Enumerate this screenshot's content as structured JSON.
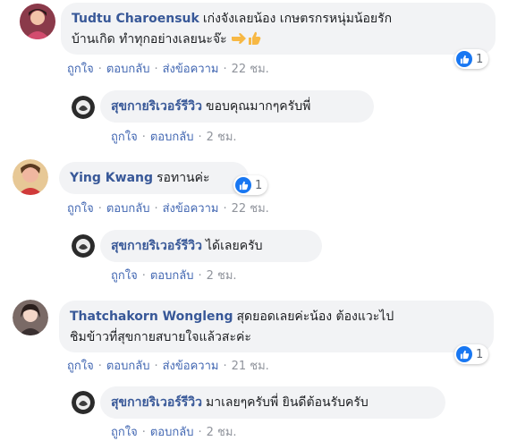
{
  "comments": [
    {
      "author": "Tudtu Charoensuk",
      "text_line1": "เก่งจังเลยน้อง เกษตรกรหนุ่มน้อยรัก",
      "text_line2": "บ้านเกิด ทำทุกอย่างเลยนะจ๊ะ",
      "emojis": [
        "point-right-icon",
        "thumbs-up-icon"
      ],
      "like_label": "ถูกใจ",
      "reply_label": "ตอบกลับ",
      "message_label": "ส่งข้อความ",
      "time": "22 ชม.",
      "reaction_count": "1",
      "avatar_color": "#c44d6a",
      "reply": {
        "author": "สุขกายริเวอร์รีวิว",
        "text": "ขอบคุณมากๆครับพี่",
        "like_label": "ถูกใจ",
        "reply_label": "ตอบกลับ",
        "time": "2 ชม."
      }
    },
    {
      "author": "Ying Kwang",
      "text_line1": "รอทานค่ะ",
      "like_label": "ถูกใจ",
      "reply_label": "ตอบกลับ",
      "message_label": "ส่งข้อความ",
      "time": "22 ชม.",
      "reaction_count": "1",
      "avatar_color": "#d9a043",
      "reply": {
        "author": "สุขกายริเวอร์รีวิว",
        "text": "ได้เลยครับ",
        "like_label": "ถูกใจ",
        "reply_label": "ตอบกลับ",
        "time": "2 ชม."
      }
    },
    {
      "author": "Thatchakorn Wongleng",
      "text_line1": "สุดยอดเลยค่ะน้อง ต้องแวะไป",
      "text_line2": "ชิมข้าวที่สุขกายสบายใจแล้วสะค่ะ",
      "like_label": "ถูกใจ",
      "reply_label": "ตอบกลับ",
      "message_label": "ส่งข้อความ",
      "time": "21 ชม.",
      "reaction_count": "1",
      "avatar_color": "#6e5b57",
      "reply": {
        "author": "สุขกายริเวอร์รีวิว",
        "text": "มาเลยๆครับพี่ ยินดีต้อนรับครับ",
        "like_label": "ถูกใจ",
        "reply_label": "ตอบกลับ",
        "time": "2 ชม."
      }
    }
  ],
  "dot": "·",
  "colors": {
    "link": "#4267b2",
    "author": "#385898",
    "bubble": "#f2f3f5",
    "meta": "#90949c",
    "like": "#1877f2"
  }
}
